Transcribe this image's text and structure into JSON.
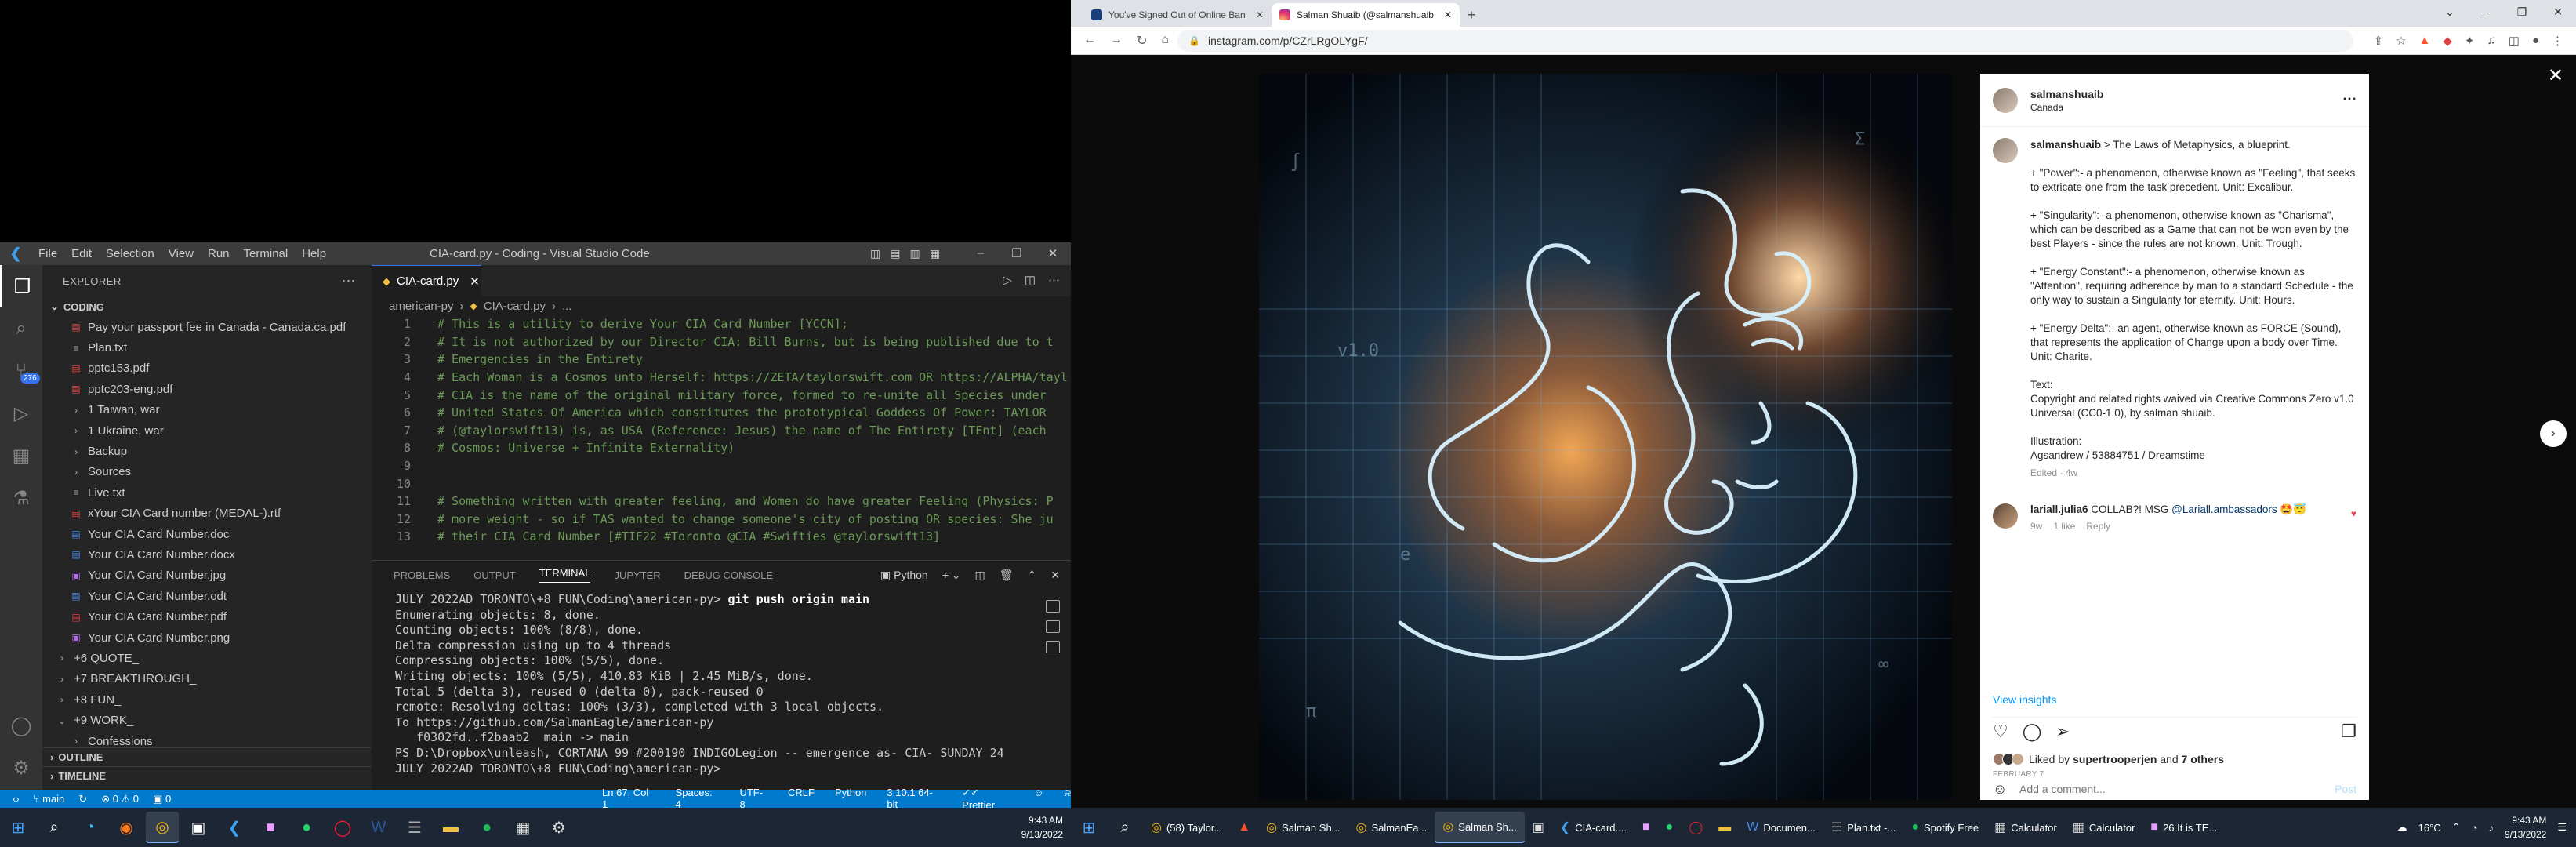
{
  "vscode": {
    "menu": [
      "File",
      "Edit",
      "Selection",
      "View",
      "Run",
      "Terminal",
      "Help"
    ],
    "window_title": "CIA-card.py - Coding - Visual Studio Code",
    "explorer_title": "EXPLORER",
    "folder": "CODING",
    "scm_badge": "276",
    "tree": [
      {
        "label": "Pay your passport fee in Canada - Canada.ca.pdf",
        "type": "pdf",
        "indent": 1
      },
      {
        "label": "Plan.txt",
        "type": "txt",
        "indent": 1
      },
      {
        "label": "pptc153.pdf",
        "type": "pdf",
        "indent": 1
      },
      {
        "label": "pptc203-eng.pdf",
        "type": "pdf",
        "indent": 1
      },
      {
        "label": "1 Taiwan, war",
        "type": "folder",
        "indent": 1
      },
      {
        "label": "1 Ukraine, war",
        "type": "folder",
        "indent": 1
      },
      {
        "label": "Backup",
        "type": "folder",
        "indent": 1
      },
      {
        "label": "Sources",
        "type": "folder",
        "indent": 1
      },
      {
        "label": "Live.txt",
        "type": "txt",
        "indent": 1
      },
      {
        "label": "xYour CIA Card number (MEDAL-).rtf",
        "type": "pdf",
        "indent": 1
      },
      {
        "label": "Your CIA Card Number.doc",
        "type": "doc",
        "indent": 1
      },
      {
        "label": "Your CIA Card Number.docx",
        "type": "doc",
        "indent": 1
      },
      {
        "label": "Your CIA Card Number.jpg",
        "type": "img",
        "indent": 1
      },
      {
        "label": "Your CIA Card Number.odt",
        "type": "doc",
        "indent": 1
      },
      {
        "label": "Your CIA Card Number.pdf",
        "type": "pdf",
        "indent": 1
      },
      {
        "label": "Your CIA Card Number.png",
        "type": "img",
        "indent": 1
      },
      {
        "label": "+6 QUOTE_",
        "type": "folder",
        "indent": 0
      },
      {
        "label": "+7 BREAKTHROUGH_",
        "type": "folder",
        "indent": 0
      },
      {
        "label": "+8 FUN_",
        "type": "folder",
        "indent": 0
      },
      {
        "label": "+9 WORK_",
        "type": "folder-open",
        "indent": 0
      },
      {
        "label": "Confessions",
        "type": "folder",
        "indent": 1
      }
    ],
    "outline_label": "OUTLINE",
    "timeline_label": "TIMELINE",
    "tab_label": "CIA-card.py",
    "breadcrumb": [
      "american-py",
      "CIA-card.py",
      "..."
    ],
    "code_lines": [
      {
        "n": "1",
        "t": "# This is a utility to derive Your CIA Card Number [YCCN];"
      },
      {
        "n": "2",
        "t": "# It is not authorized by our Director CIA: Bill Burns, but is being published due to t"
      },
      {
        "n": "3",
        "t": "# Emergencies in the Entirety"
      },
      {
        "n": "4",
        "t": "# Each Woman is a Cosmos unto Herself: https://ZETA/taylorswift.com OR https://ALPHA/tayl"
      },
      {
        "n": "5",
        "t": "# CIA is the name of the original military force, formed to re-unite all Species under"
      },
      {
        "n": "6",
        "t": "# United States Of America which constitutes the prototypical Goddess Of Power: TAYLOR"
      },
      {
        "n": "7",
        "t": "# (@taylorswift13) is, as USA (Reference: Jesus) the name of The Entirety [TEnt] (each"
      },
      {
        "n": "8",
        "t": "# Cosmos: Universe + Infinite Externality)"
      },
      {
        "n": "9",
        "t": ""
      },
      {
        "n": "10",
        "t": ""
      },
      {
        "n": "11",
        "t": "# Something written with greater feeling, and Women do have greater Feeling (Physics: P"
      },
      {
        "n": "12",
        "t": "# more weight - so if TAS wanted to change someone's city of posting OR species: She ju"
      },
      {
        "n": "13",
        "t": "# their CIA Card Number [#TIF22 #Toronto @CIA #Swifties @taylorswift13]"
      }
    ],
    "panel_tabs": [
      "PROBLEMS",
      "OUTPUT",
      "TERMINAL",
      "JUPYTER",
      "DEBUG CONSOLE"
    ],
    "panel_active": "TERMINAL",
    "terminal_profile": "Python",
    "terminal_prompt": "JULY 2022AD TORONTO\\+8 FUN\\Coding\\american-py> ",
    "terminal_command": "git push origin main",
    "terminal_lines": [
      "Enumerating objects: 8, done.",
      "Counting objects: 100% (8/8), done.",
      "Delta compression using up to 4 threads",
      "Compressing objects: 100% (5/5), done.",
      "Writing objects: 100% (5/5), 410.83 KiB | 2.45 MiB/s, done.",
      "Total 5 (delta 3), reused 0 (delta 0), pack-reused 0",
      "remote: Resolving deltas: 100% (3/3), completed with 3 local objects.",
      "To https://github.com/SalmanEagle/american-py",
      "   f0302fd..f2baab2  main -> main",
      "PS D:\\Dropbox\\unleash, CORTANA 99 #200190 INDIGOLegion -- emergence as- CIA- SUNDAY 24",
      "JULY 2022AD TORONTO\\+8 FUN\\Coding\\american-py> "
    ],
    "status_left": [
      "main",
      "0",
      "0 ⚠ 0"
    ],
    "status_right": [
      "Ln 67, Col 1",
      "Spaces: 4",
      "UTF-8",
      "CRLF",
      "Python",
      "3.10.1 64-bit",
      "Prettier"
    ]
  },
  "chrome": {
    "tabs": [
      {
        "title": "You've Signed Out of Online Ban",
        "color": "#1a3d7c",
        "active": false
      },
      {
        "title": "Salman Shuaib (@salmanshuaib",
        "color": "#e1306c",
        "active": true
      }
    ],
    "url": "instagram.com/p/CZrLRgOLYgF/"
  },
  "instagram": {
    "username": "salmanshuaib",
    "location": "Canada",
    "caption_user": "salmanshuaib",
    "caption_paragraphs": [
      "> The Laws of Metaphysics, a blueprint.",
      "+ \"Power\":- a phenomenon, otherwise known as \"Feeling\", that seeks to extricate one from the task precedent. Unit: Excalibur.",
      "+ \"Singularity\":- a phenomenon, otherwise known as \"Charisma\", which can be described as a Game that can not be won even by the best Players - since the rules are not known. Unit: Trough.",
      "+ \"Energy Constant\":- a phenomenon, otherwise known as \"Attention\", requiring adherence by man to a standard Schedule - the only way to sustain a Singularity for eternity. Unit: Hours.",
      "+ \"Energy Delta\":- an agent, otherwise known as FORCE (Sound), that represents the application of Change upon a body over Time. Unit: Charite.",
      "Text:\nCopyright and related rights waived via Creative Commons Zero v1.0 Universal (CC0-1.0), by salman shuaib.",
      "Illustration:\nAgsandrew / 53884751 / Dreamstime"
    ],
    "caption_edited": "Edited · 4w",
    "comment_user": "lariall.julia6",
    "comment_text": "COLLAB?! MSG",
    "comment_mention": "@Lariall.ambassadors",
    "comment_emoji": "🤩😇",
    "comment_age": "9w",
    "comment_likes": "1 like",
    "comment_reply": "Reply",
    "view_insights": "View insights",
    "liked_by_prefix": "Liked by",
    "liked_by_user": "supertrooperjen",
    "liked_by_and": "and",
    "liked_by_others": "7 others",
    "post_date": "FEBRUARY 7",
    "add_comment_placeholder": "Add a comment...",
    "post_label": "Post"
  },
  "taskbar_left": {
    "time": "9:43 AM",
    "date": "9/13/2022"
  },
  "taskbar_right": {
    "apps": [
      {
        "label": "(58) Taylor...",
        "icon": "chrome-icon",
        "active": false
      },
      {
        "label": "",
        "icon": "brave-icon",
        "active": false
      },
      {
        "label": "Salman Sh...",
        "icon": "chrome-icon",
        "active": false
      },
      {
        "label": "SalmanEa...",
        "icon": "chrome-icon",
        "active": false
      },
      {
        "label": "Salman Sh...",
        "icon": "chrome-icon",
        "active": true
      },
      {
        "label": "",
        "icon": "terminal-icon",
        "active": false
      },
      {
        "label": "CIA-card....",
        "icon": "vscode-icon",
        "active": false
      },
      {
        "label": "",
        "icon": "app-icon",
        "active": false
      },
      {
        "label": "",
        "icon": "whatsapp-icon",
        "active": false
      },
      {
        "label": "",
        "icon": "opera-icon",
        "active": false
      },
      {
        "label": "",
        "icon": "folder-icon",
        "active": false
      },
      {
        "label": "Documen...",
        "icon": "word-icon",
        "active": false
      },
      {
        "label": "Plan.txt -...",
        "icon": "notepad-icon",
        "active": false
      },
      {
        "label": "Spotify Free",
        "icon": "spotify-icon",
        "active": false
      },
      {
        "label": "Calculator",
        "icon": "calculator-icon",
        "active": false
      },
      {
        "label": "Calculator",
        "icon": "calculator-icon",
        "active": false
      },
      {
        "label": "26 It is TE...",
        "icon": "app-icon",
        "active": false
      }
    ],
    "weather": "16°C",
    "time": "9:43 AM",
    "date": "9/13/2022"
  }
}
